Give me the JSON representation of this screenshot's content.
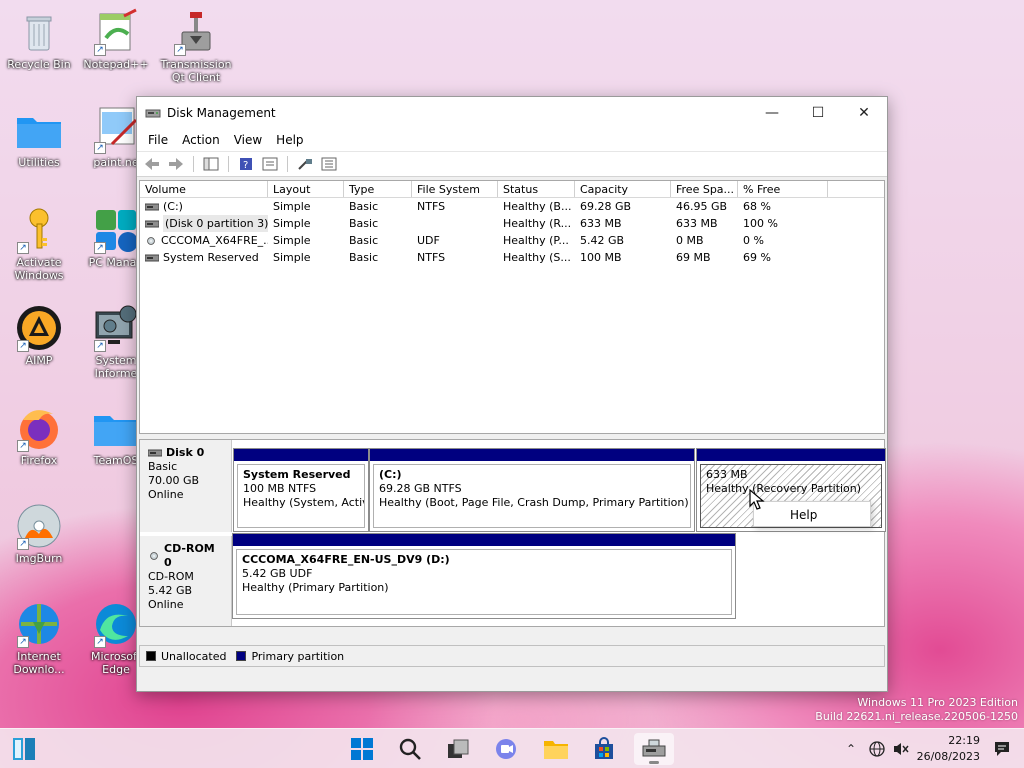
{
  "desktop": {
    "icons": [
      {
        "id": "recycle-bin",
        "label": "Recycle Bin",
        "shortcut": false
      },
      {
        "id": "notepadpp",
        "label": "Notepad++",
        "shortcut": true
      },
      {
        "id": "transmission",
        "label": "Transmission Qt Client",
        "shortcut": true
      },
      {
        "id": "utilities",
        "label": "Utilities",
        "shortcut": false
      },
      {
        "id": "paint",
        "label": "paint.ne",
        "shortcut": true
      },
      {
        "id": "activate",
        "label": "Activate Windows",
        "shortcut": true
      },
      {
        "id": "pcmanager",
        "label": "PC Manag",
        "shortcut": true
      },
      {
        "id": "aimp",
        "label": "AIMP",
        "shortcut": true
      },
      {
        "id": "sysinfo",
        "label": "System Informe",
        "shortcut": true
      },
      {
        "id": "firefox",
        "label": "Firefox",
        "shortcut": true
      },
      {
        "id": "teamos",
        "label": "TeamOS",
        "shortcut": false
      },
      {
        "id": "imgburn",
        "label": "ImgBurn",
        "shortcut": true
      },
      {
        "id": "idm",
        "label": "Internet Downlo...",
        "shortcut": true
      },
      {
        "id": "edge",
        "label": "Microsoft Edge",
        "shortcut": true
      }
    ]
  },
  "window": {
    "title": "Disk Management",
    "controls": {
      "minimize": "—",
      "maximize": "☐",
      "close": "✕"
    },
    "menu": [
      "File",
      "Action",
      "View",
      "Help"
    ]
  },
  "volume_list": {
    "columns": [
      "Volume",
      "Layout",
      "Type",
      "File System",
      "Status",
      "Capacity",
      "Free Spa...",
      "% Free"
    ],
    "rows": [
      {
        "volume": "(C:)",
        "layout": "Simple",
        "type": "Basic",
        "fs": "NTFS",
        "status": "Healthy (B...",
        "capacity": "69.28 GB",
        "free": "46.95 GB",
        "pct": "68 %",
        "icon": "disk"
      },
      {
        "volume": "(Disk 0 partition 3)",
        "layout": "Simple",
        "type": "Basic",
        "fs": "",
        "status": "Healthy (R...",
        "capacity": "633 MB",
        "free": "633 MB",
        "pct": "100 %",
        "icon": "disk"
      },
      {
        "volume": "CCCOMA_X64FRE_...",
        "layout": "Simple",
        "type": "Basic",
        "fs": "UDF",
        "status": "Healthy (P...",
        "capacity": "5.42 GB",
        "free": "0 MB",
        "pct": "0 %",
        "icon": "cd"
      },
      {
        "volume": "System Reserved",
        "layout": "Simple",
        "type": "Basic",
        "fs": "NTFS",
        "status": "Healthy (S...",
        "capacity": "100 MB",
        "free": "69 MB",
        "pct": "69 %",
        "icon": "disk"
      }
    ]
  },
  "disks": [
    {
      "name": "Disk 0",
      "type": "Basic",
      "size": "70.00 GB",
      "state": "Online",
      "partitions": [
        {
          "name": "System Reserved",
          "size_fs": "100 MB NTFS",
          "status": "Healthy (System, Active, Primary Partition)"
        },
        {
          "name": "(C:)",
          "size_fs": "69.28 GB NTFS",
          "status": "Healthy (Boot, Page File, Crash Dump, Primary Partition)"
        },
        {
          "name": "",
          "size_fs": "633 MB",
          "status": "Healthy (Recovery Partition)"
        }
      ]
    },
    {
      "name": "CD-ROM 0",
      "type": "CD-ROM",
      "size": "5.42 GB",
      "state": "Online",
      "partitions": [
        {
          "name": "CCCOMA_X64FRE_EN-US_DV9  (D:)",
          "size_fs": "5.42 GB UDF",
          "status": "Healthy (Primary Partition)"
        }
      ]
    }
  ],
  "legend": [
    {
      "label": "Unallocated",
      "color": "#000000"
    },
    {
      "label": "Primary partition",
      "color": "#000080"
    }
  ],
  "context_menu": {
    "items": [
      "Help"
    ]
  },
  "watermark": {
    "line1": "Windows 11 Pro 2023 Edition",
    "line2": "Build 22621.ni_release.220506-1250"
  },
  "taskbar": {
    "apps": [
      "start",
      "search",
      "task-view",
      "teams",
      "file-explorer",
      "store",
      "disk-management"
    ],
    "clock": {
      "time": "22:19",
      "date": "26/08/2023"
    }
  },
  "colors": {
    "primary_partition": "#000080",
    "accent": "#0067c0"
  }
}
